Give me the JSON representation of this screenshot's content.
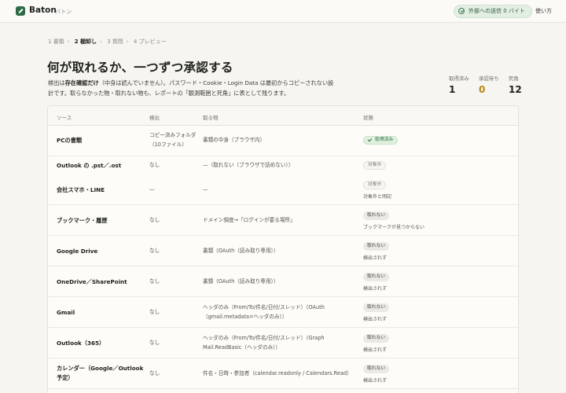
{
  "app": {
    "name": "Baton",
    "subtitle": "バトン"
  },
  "header": {
    "status_pill": "外部への送信 0 バイト",
    "help_link": "使い方"
  },
  "breadcrumb": [
    {
      "label": "1 書類",
      "active": false
    },
    {
      "label": "2 棚卸し",
      "active": true
    },
    {
      "label": "3 質問",
      "active": false
    },
    {
      "label": "4 プレビュー",
      "active": false
    }
  ],
  "page": {
    "title": "何が取れるか、一つずつ承認する",
    "desc_part1": "検出は",
    "desc_bold": "存在確認だけ",
    "desc_part2": "（中身は読んでいません）。パスワード・Cookie・Login Data は最初からコピーされない設計です。取らなかった物・取れない物も、レポートの「観測範囲と死角」に表として残ります。"
  },
  "stats": [
    {
      "label": "取得済み",
      "value": "1"
    },
    {
      "label": "承認待ち",
      "value": "0"
    },
    {
      "label": "死角",
      "value": "12"
    }
  ],
  "table": {
    "headers": [
      "ソース",
      "検出",
      "取る物",
      "状態"
    ],
    "rows": [
      {
        "source": "PCの書類",
        "detect": "コピー済みフォルダ（10ファイル）",
        "take": "書類の中身（ブラウザ内）",
        "status": "取得済み",
        "status_kind": "ok",
        "note": ""
      },
      {
        "source": "Outlook の .pst／.ost",
        "detect": "なし",
        "take": "—（取れない（ブラウザで読めない））",
        "status": "対象外",
        "status_kind": "ex",
        "note": ""
      },
      {
        "source": "会社スマホ・LINE",
        "detect": "—",
        "take": "—",
        "status": "対象外",
        "status_kind": "ex",
        "note": "対象外と明記"
      },
      {
        "source": "ブックマーク・履歴",
        "detect": "なし",
        "take": "ドメイン頻度→「ログインが要る場所」",
        "status": "取れない",
        "status_kind": "no",
        "note": "ブックマークが見つからない"
      },
      {
        "source": "Google Drive",
        "detect": "なし",
        "take": "書類（OAuth（読み取り専用））",
        "status": "取れない",
        "status_kind": "no",
        "note": "検出されず"
      },
      {
        "source": "OneDrive／SharePoint",
        "detect": "なし",
        "take": "書類（OAuth（読み取り専用））",
        "status": "取れない",
        "status_kind": "no",
        "note": "検出されず"
      },
      {
        "source": "Gmail",
        "detect": "なし",
        "take": "ヘッダのみ（From/To/件名/日付/スレッド）（OAuth（gmail.metadata=ヘッダのみ））",
        "status": "取れない",
        "status_kind": "no",
        "note": "検出されず"
      },
      {
        "source": "Outlook（365）",
        "detect": "なし",
        "take": "ヘッダのみ（From/To/件名/日付/スレッド）（Graph Mail.ReadBasic（ヘッダのみ））",
        "status": "取れない",
        "status_kind": "no",
        "note": "検出されず"
      },
      {
        "source": "カレンダー（Google／Outlook 予定）",
        "detect": "なし",
        "take": "件名・日時・参加者（calendar.readonly / Calendars.Read）",
        "status": "取れない",
        "status_kind": "no",
        "note": "検出されず"
      }
    ]
  },
  "icons": {
    "logo": "baton-logo-icon",
    "pill": "check-circle-icon",
    "ok_badge": "check-icon"
  },
  "colors": {
    "accent": "#2e6a45",
    "warn": "#b8861a",
    "background": "#f6f5f1"
  }
}
